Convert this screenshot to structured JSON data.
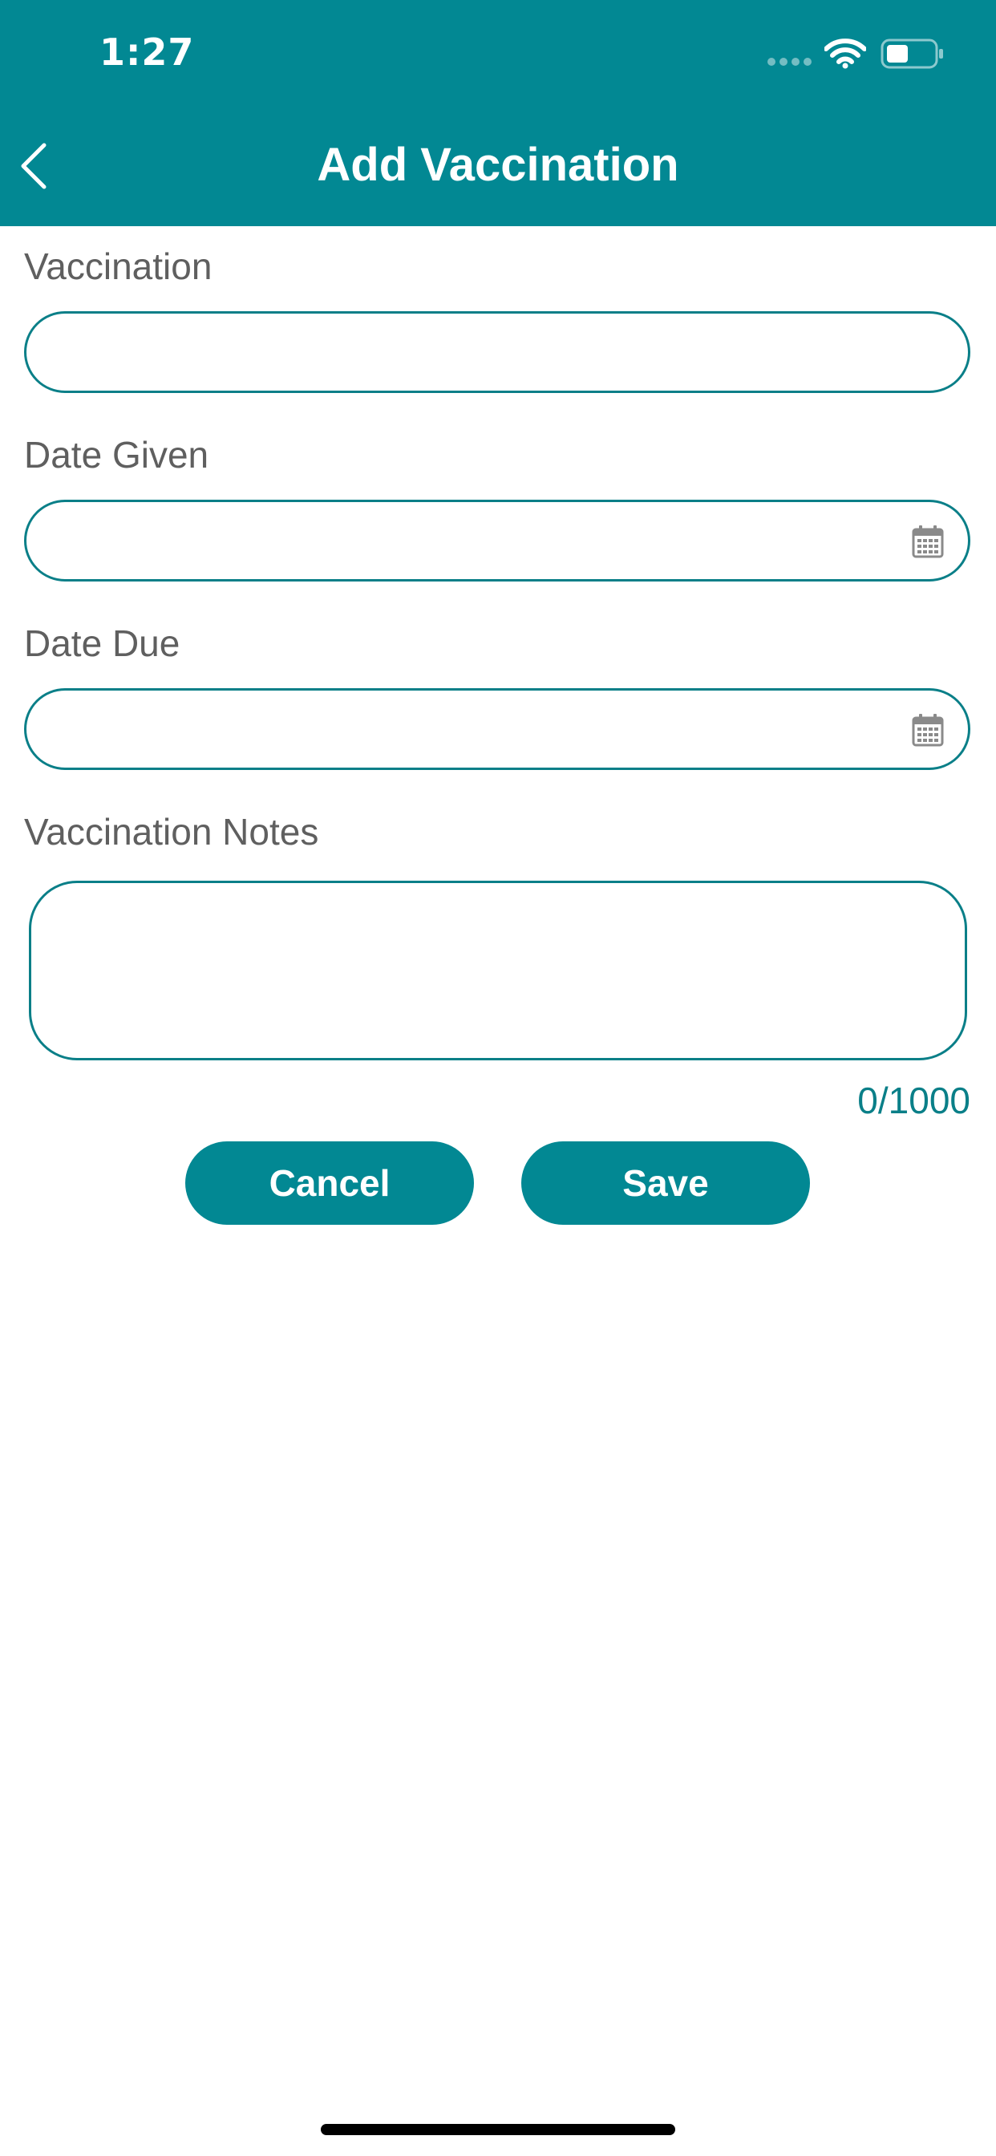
{
  "status_bar": {
    "time": "1:27"
  },
  "header": {
    "title": "Add Vaccination"
  },
  "form": {
    "vaccination": {
      "label": "Vaccination",
      "value": ""
    },
    "date_given": {
      "label": "Date Given",
      "value": ""
    },
    "date_due": {
      "label": "Date Due",
      "value": ""
    },
    "notes": {
      "label": "Vaccination Notes",
      "value": "",
      "char_count": "0/1000"
    }
  },
  "buttons": {
    "cancel": "Cancel",
    "save": "Save"
  },
  "colors": {
    "primary": "#028893",
    "border": "#0a7f88",
    "label": "#5f5f5f"
  },
  "icons": [
    "chevron-left-icon",
    "wifi-icon",
    "battery-icon",
    "calendar-icon"
  ]
}
